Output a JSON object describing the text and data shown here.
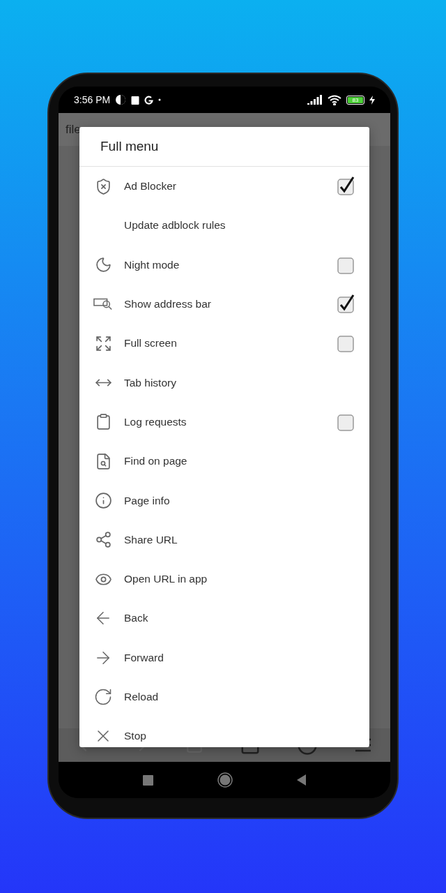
{
  "status_bar": {
    "time": "3:56 PM",
    "battery": "83"
  },
  "address_bar": {
    "text": "file"
  },
  "dialog": {
    "title": "Full menu",
    "items": [
      {
        "label": "Ad Blocker",
        "kind": "checkbox",
        "checked": true
      },
      {
        "label": "Update adblock rules",
        "kind": "plain"
      },
      {
        "label": "Night mode",
        "kind": "checkbox",
        "checked": false
      },
      {
        "label": "Show address bar",
        "kind": "checkbox",
        "checked": true
      },
      {
        "label": "Full screen",
        "kind": "checkbox",
        "checked": false
      },
      {
        "label": "Tab history",
        "kind": "plain"
      },
      {
        "label": "Log requests",
        "kind": "checkbox",
        "checked": false
      },
      {
        "label": "Find on page",
        "kind": "plain"
      },
      {
        "label": "Page info",
        "kind": "plain"
      },
      {
        "label": "Share URL",
        "kind": "plain"
      },
      {
        "label": "Open URL in app",
        "kind": "plain"
      },
      {
        "label": "Back",
        "kind": "plain"
      },
      {
        "label": "Forward",
        "kind": "plain"
      },
      {
        "label": "Reload",
        "kind": "plain"
      },
      {
        "label": "Stop",
        "kind": "plain"
      }
    ]
  }
}
